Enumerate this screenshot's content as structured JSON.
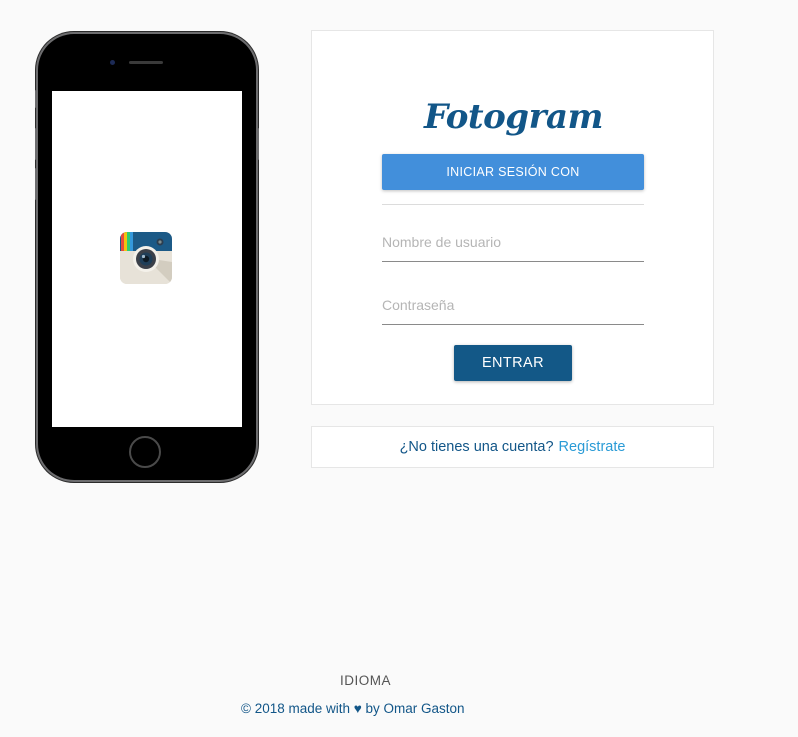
{
  "app": {
    "logo_text": "Fotogram"
  },
  "login": {
    "login_with_label": "INICIAR SESIÓN CON",
    "username_placeholder": "Nombre de usuario",
    "password_placeholder": "Contraseña",
    "submit_label": "ENTRAR"
  },
  "signup": {
    "prompt": "¿No tienes una cuenta?",
    "link_label": "Regístrate"
  },
  "footer": {
    "language_label": "IDIOMA",
    "copyright": "© 2018 made with ♥ by Omar Gaston"
  },
  "colors": {
    "brand": "#125688",
    "primary_button": "#428fdb",
    "submit_button": "#135887",
    "link": "#2a9bd6",
    "background": "#fafafa"
  },
  "icons": {
    "app_icon": "camera-app-icon"
  }
}
